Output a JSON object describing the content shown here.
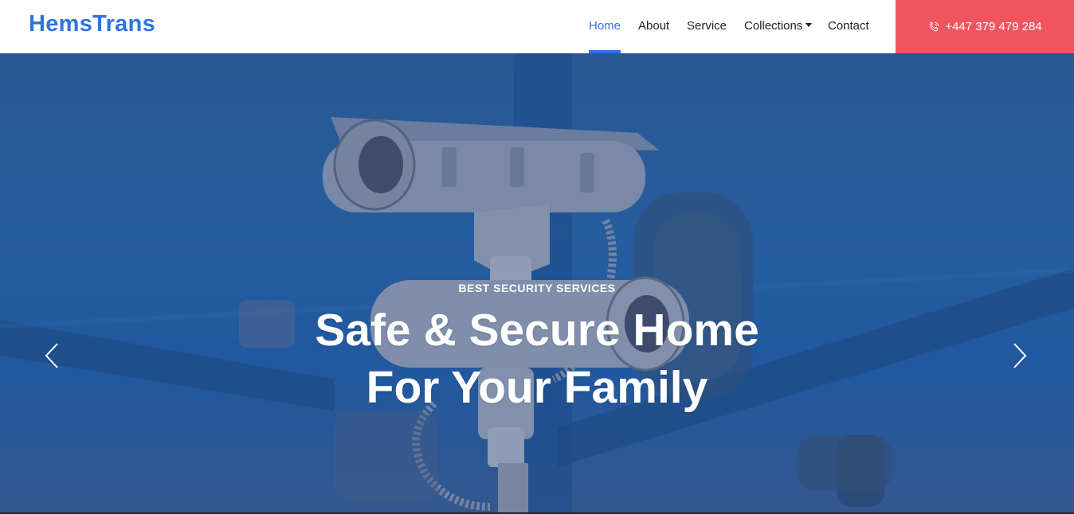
{
  "brand": "HemsTrans",
  "nav": {
    "items": [
      {
        "label": "Home",
        "active": true
      },
      {
        "label": "About",
        "active": false
      },
      {
        "label": "Service",
        "active": false
      },
      {
        "label": "Collections",
        "active": false,
        "dropdown": true
      },
      {
        "label": "Contact",
        "active": false
      }
    ],
    "phone": "+447 379 479 284",
    "phone_icon": "phone-icon"
  },
  "hero": {
    "subtitle": "BEST SECURITY SERVICES",
    "title_line1": "Safe & Secure Home",
    "title_line2": "For Your Family",
    "prev_icon": "chevron-left-icon",
    "next_icon": "chevron-right-icon"
  },
  "colors": {
    "brand": "#2f73e0",
    "accent": "#f0555f",
    "hero_blue": "#2a64a6"
  }
}
